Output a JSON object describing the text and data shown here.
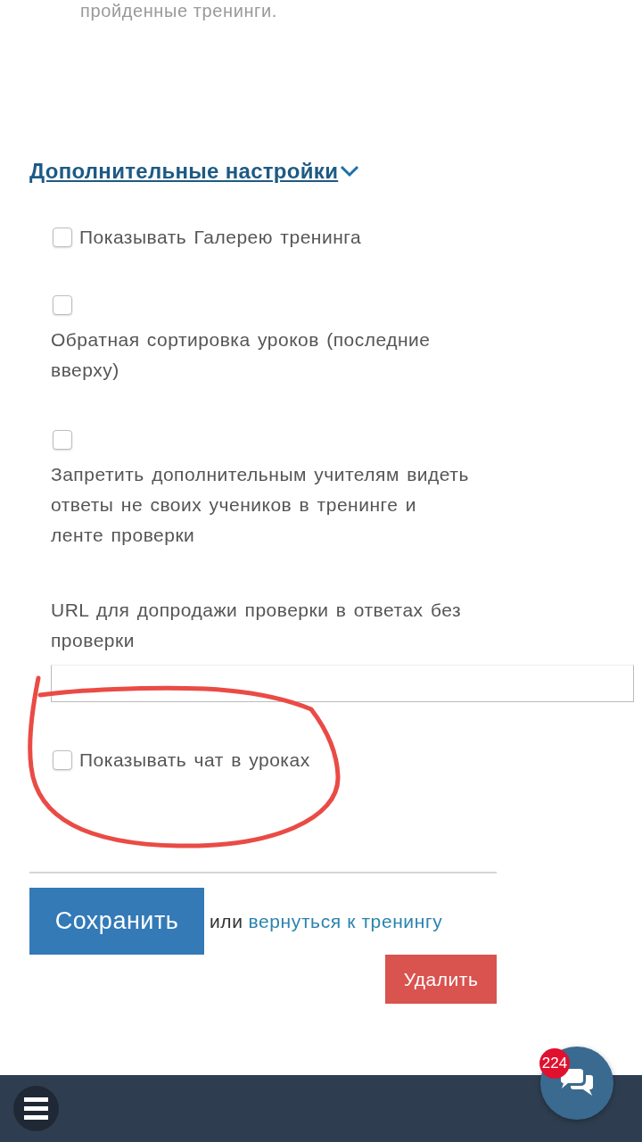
{
  "intro_text": "пройденные тренинги.",
  "section": {
    "title": "Дополнительные настройки",
    "expanded": true
  },
  "settings": [
    {
      "kind": "inline",
      "label": "Показывать Галерею тренинга",
      "checked": false
    },
    {
      "kind": "stacked",
      "label": "Обратная сортировка уроков (последние вверху)",
      "checked": false
    },
    {
      "kind": "stacked",
      "label": "Запретить дополнительным учителям видеть ответы не своих учеников в тренинге и ленте проверки",
      "checked": false
    },
    {
      "kind": "field",
      "label": "URL для допродажи проверки в ответах без проверки"
    },
    {
      "kind": "inline",
      "label": "Показывать чат в уроках",
      "checked": false
    }
  ],
  "actions": {
    "save": "Сохранить",
    "or_text": "или",
    "back_link": "вернуться к тренингу",
    "delete": "Удалить"
  },
  "chat": {
    "badge": "224"
  }
}
